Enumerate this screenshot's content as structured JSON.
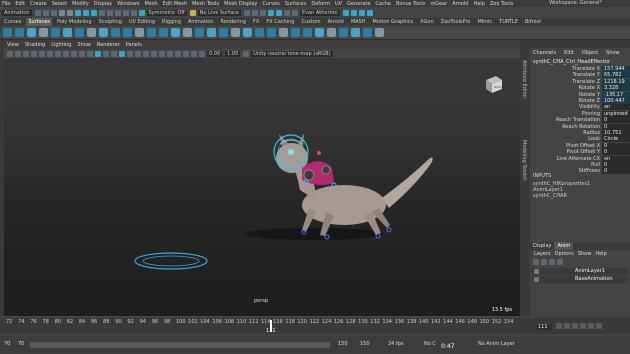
{
  "menubar": {
    "items": [
      "File",
      "Edit",
      "Create",
      "Select",
      "Modify",
      "Display",
      "Windows",
      "Mesh",
      "Edit Mesh",
      "Mesh Tools",
      "Mesh Display",
      "Curves",
      "Surfaces",
      "Deform",
      "UV",
      "Generate",
      "Cache",
      "Bonus Tools",
      "mGear",
      "Arnold",
      "Help",
      "Zoo Tools"
    ],
    "workspace_label": "Workspace:",
    "workspace_value": "General*"
  },
  "statusline": {
    "mode": "Animation",
    "symmetry": "Symmetry: Off",
    "live_surface": "No Live Surface",
    "user": "Evan Atherton"
  },
  "shelf": {
    "tabs": [
      "Curves",
      "Surfaces",
      "Poly Modeling",
      "Sculpting",
      "UV Editing",
      "Rigging",
      "Animation",
      "Rendering",
      "FX",
      "FX Caching",
      "Custom",
      "Arnold",
      "MASH",
      "Motion Graphics",
      "XGen",
      "ZooToolsPro",
      "Mimic",
      "TURTLE",
      "Bifrost"
    ],
    "active_tab": "Surfaces"
  },
  "viewport": {
    "menu": [
      "View",
      "Shading",
      "Lighting",
      "Show",
      "Renderer",
      "Panels"
    ],
    "field_a": "0.00",
    "field_b": "1.00",
    "colorspace": "Unity neutral tone-map (sRGB)",
    "camera": "persp",
    "fps": "13.5 fps",
    "viewcube_label": "BACK"
  },
  "right_edge": {
    "attribute_editor": "Attribute Editor",
    "modeling_toolkit": "Modeling Toolkit"
  },
  "channel_box": {
    "tabs": [
      "Channels",
      "Edit",
      "Object",
      "Show"
    ],
    "object": "synthC_CHA_Ctrl_HeadEffector",
    "attributes": [
      {
        "label": "Translate X",
        "value": "157.944",
        "keyed": true
      },
      {
        "label": "Translate Y",
        "value": "65.782",
        "keyed": true
      },
      {
        "label": "Translate Z",
        "value": "1218.19",
        "keyed": true
      },
      {
        "label": "Rotate X",
        "value": "3.328",
        "keyed": true
      },
      {
        "label": "Rotate Y",
        "value": "-135.17",
        "keyed": true
      },
      {
        "label": "Rotate Z",
        "value": "100.447",
        "keyed": true
      },
      {
        "label": "Visibility",
        "value": "on",
        "keyed": false
      },
      {
        "label": "Pinning",
        "value": "unpinned",
        "keyed": false
      },
      {
        "label": "Reach Translation",
        "value": "0",
        "keyed": false
      },
      {
        "label": "Reach Rotation",
        "value": "0",
        "keyed": false
      },
      {
        "label": "Radius",
        "value": "10.751",
        "keyed": false
      },
      {
        "label": "Look",
        "value": "Circle",
        "keyed": false
      },
      {
        "label": "Pivot Offset X",
        "value": "0",
        "keyed": false
      },
      {
        "label": "Pivot Offset Y",
        "value": "0",
        "keyed": false
      },
      {
        "label": "Live Alternate CX",
        "value": "on",
        "keyed": false
      },
      {
        "label": "Pull",
        "value": "0",
        "keyed": false
      },
      {
        "label": "Stiffness",
        "value": "0",
        "keyed": false
      }
    ],
    "inputs_label": "INPUTS",
    "inputs": [
      "synthC_HIKproperties1",
      "AnimLayer1",
      "synthC_CHAR"
    ]
  },
  "layer_editor": {
    "tabs": [
      "Display",
      "Anim"
    ],
    "active_tab": "Anim",
    "menu": [
      "Layers",
      "Options",
      "Show",
      "Help"
    ],
    "layers": [
      "AnimLayer1",
      "BaseAnimation"
    ]
  },
  "timeline": {
    "ticks": [
      "72",
      "74",
      "76",
      "78",
      "80",
      "82",
      "84",
      "86",
      "88",
      "90",
      "92",
      "94",
      "96",
      "98",
      "100",
      "102",
      "104",
      "106",
      "108",
      "110",
      "112",
      "114",
      "116",
      "118",
      "120",
      "122",
      "124",
      "126",
      "128",
      "130",
      "132",
      "134",
      "136",
      "138",
      "140",
      "142",
      "144",
      "146",
      "148",
      "150",
      "152",
      "154"
    ],
    "current_frame": "111",
    "range_start": "70",
    "range_end": "150",
    "playback_end": "150",
    "range_out": "150",
    "fps_setting": "24 fps",
    "no_character": "No C",
    "anim_layer": "No Anim Layer",
    "timecode": "0:47"
  }
}
